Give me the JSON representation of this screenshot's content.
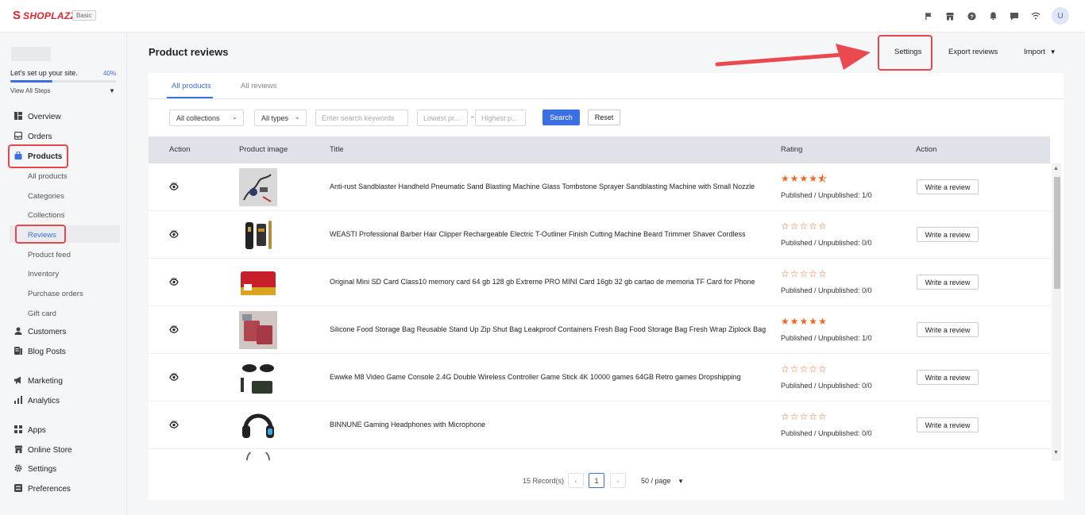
{
  "brand": {
    "name": "SHOPLAZZA",
    "plan": "Basic"
  },
  "topbar": {
    "icons": [
      "flag-icon",
      "store-icon",
      "help-icon",
      "bell-icon",
      "chat-icon",
      "wifi-icon"
    ],
    "avatar": "U"
  },
  "sidebar": {
    "setup_label": "Let's set up your site.",
    "setup_percent": "40%",
    "setup_progress": 0.4,
    "view_steps": "View All Steps",
    "items": [
      {
        "label": "Overview",
        "icon": "overview-icon"
      },
      {
        "label": "Orders",
        "icon": "orders-icon"
      },
      {
        "label": "Products",
        "icon": "products-icon"
      },
      {
        "label": "Customers",
        "icon": "customers-icon"
      },
      {
        "label": "Blog Posts",
        "icon": "blog-icon"
      },
      {
        "label": "Marketing",
        "icon": "marketing-icon"
      },
      {
        "label": "Analytics",
        "icon": "analytics-icon"
      },
      {
        "label": "Apps",
        "icon": "apps-icon"
      },
      {
        "label": "Online Store",
        "icon": "online-store-icon"
      },
      {
        "label": "Settings",
        "icon": "gear-icon"
      },
      {
        "label": "Preferences",
        "icon": "preferences-icon"
      }
    ],
    "product_subitems": [
      "All products",
      "Categories",
      "Collections",
      "Reviews",
      "Product feed",
      "Inventory",
      "Purchase orders",
      "Gift card"
    ],
    "active_subitem": "Reviews"
  },
  "header": {
    "title": "Product reviews",
    "settings_label": "Settings",
    "export_label": "Export reviews",
    "import_label": "Import"
  },
  "tabs": [
    {
      "label": "All products",
      "active": true
    },
    {
      "label": "All reviews",
      "active": false
    }
  ],
  "filters": {
    "collections": "All collections",
    "types": "All types",
    "keyword_placeholder": "Enter search keywords",
    "lowest_placeholder": "Lowest pr...",
    "highest_placeholder": "Highest p...",
    "search_label": "Search",
    "reset_label": "Reset"
  },
  "table": {
    "columns": [
      "Action",
      "Product image",
      "Title",
      "Rating",
      "Action"
    ],
    "rows": [
      {
        "title": "Anti-rust Sandblaster Handheld Pneumatic Sand Blasting Machine Glass Tombstone Sprayer Sandblasting Machine with Small Nozzle",
        "rating": 4.5,
        "published": "Published / Unpublished: 1/0",
        "action": "Write a review"
      },
      {
        "title": "WEASTI Professional Barber Hair Clipper Rechargeable Electric T-Outliner Finish Cutting Machine Beard Trimmer Shaver Cordless",
        "rating": 0,
        "published": "Published / Unpublished: 0/0",
        "action": "Write a review"
      },
      {
        "title": "Original Mini SD Card Class10 memory card 64 gb 128 gb Extreme PRO MINI Card 16gb 32 gb cartao de memoria TF Card for Phone",
        "rating": 0,
        "published": "Published / Unpublished: 0/0",
        "action": "Write a review"
      },
      {
        "title": "Silicone Food Storage Bag Reusable Stand Up Zip Shut Bag Leakproof Containers Fresh Bag Food Storage Bag Fresh Wrap Ziplock Bag",
        "rating": 5,
        "published": "Published / Unpublished: 1/0",
        "action": "Write a review"
      },
      {
        "title": "Ewwke M8 Video Game Console 2.4G Double Wireless Controller Game Stick 4K 10000 games 64GB Retro games Dropshipping",
        "rating": 0,
        "published": "Published / Unpublished: 0/0",
        "action": "Write a review"
      },
      {
        "title": "BINNUNE Gaming Headphones with Microphone",
        "rating": 0,
        "published": "Published / Unpublished: 0/0",
        "action": "Write a review"
      }
    ]
  },
  "pagination": {
    "records": "15 Record(s)",
    "current_page": "1",
    "per_page": "50 / page"
  },
  "colors": {
    "accent": "#3b6fe3",
    "brand": "#e6232e",
    "highlight": "#e8464c",
    "star": "#f06724"
  }
}
